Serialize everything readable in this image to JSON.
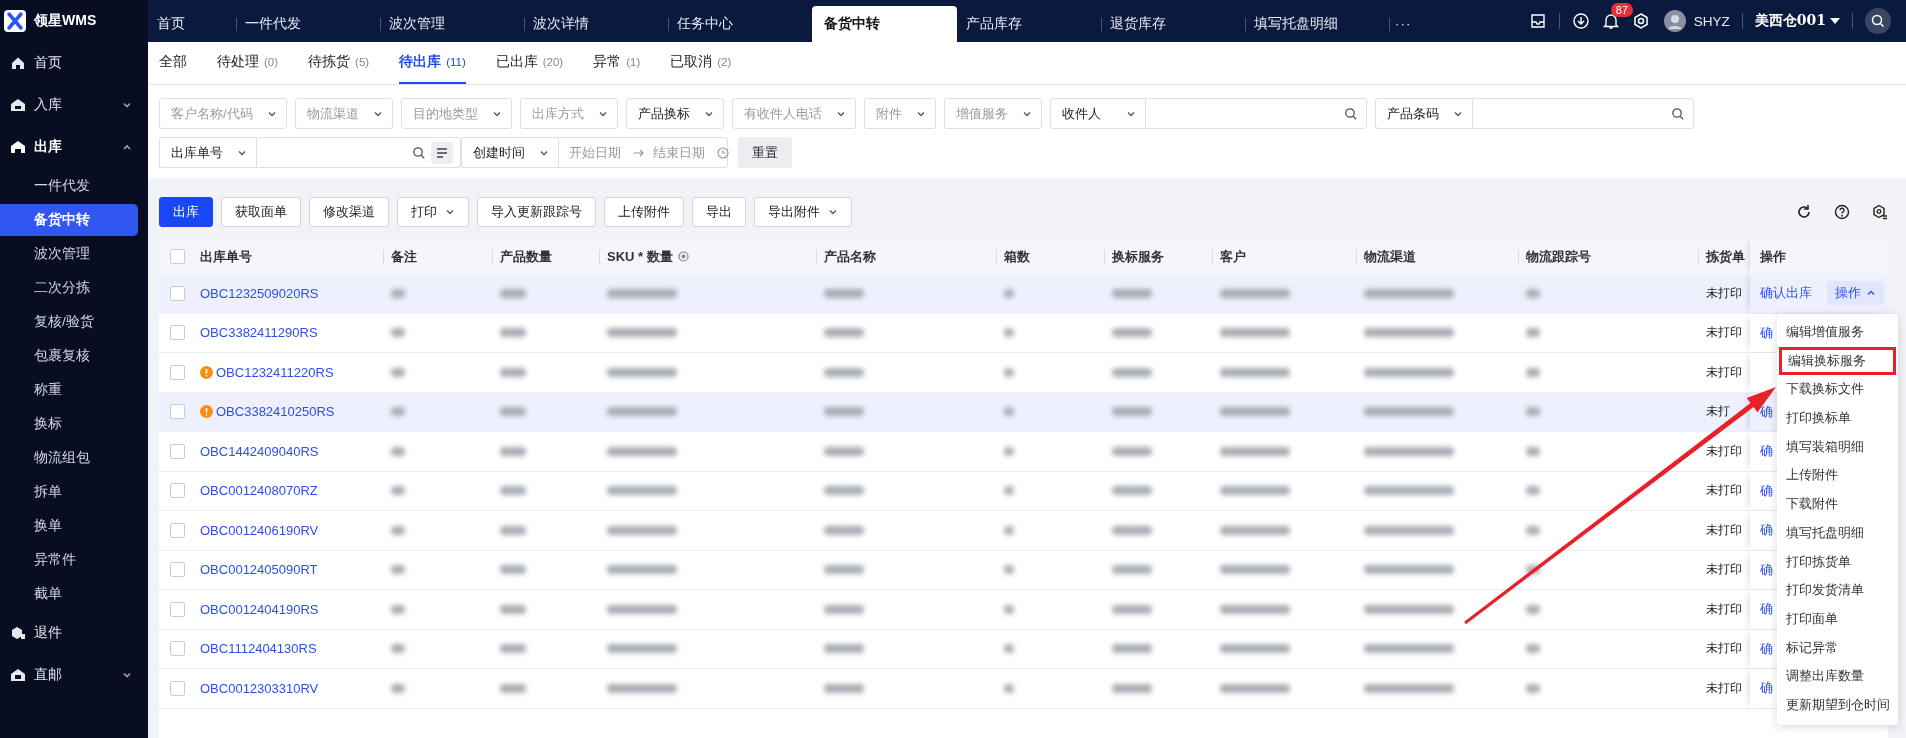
{
  "app": {
    "title": "领星WMS"
  },
  "top_tabs": [
    {
      "label": "首页",
      "selected": false
    },
    {
      "label": "一件代发",
      "selected": false
    },
    {
      "label": "波次管理",
      "selected": false
    },
    {
      "label": "波次详情",
      "selected": false
    },
    {
      "label": "任务中心",
      "selected": false
    },
    {
      "label": "备货中转",
      "selected": true
    },
    {
      "label": "产品库存",
      "selected": false
    },
    {
      "label": "退货库存",
      "selected": false
    },
    {
      "label": "填写托盘明细",
      "selected": false
    },
    {
      "label": "···",
      "selected": false
    }
  ],
  "header": {
    "notifications": "87",
    "user": "SHYZ",
    "warehouse": "美西仓001"
  },
  "sidebar": {
    "items": [
      {
        "label": "首页"
      },
      {
        "label": "入库",
        "expanded": false
      },
      {
        "label": "出库",
        "expanded": true,
        "children": [
          {
            "label": "一件代发",
            "selected": false
          },
          {
            "label": "备货中转",
            "selected": true
          },
          {
            "label": "波次管理",
            "selected": false
          },
          {
            "label": "二次分拣",
            "selected": false
          },
          {
            "label": "复核/验货",
            "selected": false
          },
          {
            "label": "包裹复核",
            "selected": false
          },
          {
            "label": "称重",
            "selected": false
          },
          {
            "label": "换标",
            "selected": false
          },
          {
            "label": "物流组包",
            "selected": false
          },
          {
            "label": "拆单",
            "selected": false
          },
          {
            "label": "换单",
            "selected": false
          },
          {
            "label": "异常件",
            "selected": false
          },
          {
            "label": "截单",
            "selected": false
          }
        ]
      },
      {
        "label": "退件"
      },
      {
        "label": "直邮",
        "expanded": false
      }
    ]
  },
  "status_tabs": [
    {
      "label": "全部",
      "selected": false
    },
    {
      "label": "待处理",
      "count": "(0)",
      "selected": false
    },
    {
      "label": "待拣货",
      "count": "(5)",
      "selected": false
    },
    {
      "label": "待出库",
      "count": "(11)",
      "selected": true
    },
    {
      "label": "已出库",
      "count": "(20)",
      "selected": false
    },
    {
      "label": "异常",
      "count": "(1)",
      "selected": false
    },
    {
      "label": "已取消",
      "count": "(2)",
      "selected": false
    }
  ],
  "filters": [
    [
      {
        "kind": "select",
        "placeholder": "客户名称/代码"
      },
      {
        "kind": "select",
        "placeholder": "物流渠道"
      },
      {
        "kind": "select",
        "placeholder": "目的地类型"
      },
      {
        "kind": "select",
        "placeholder": "出库方式"
      },
      {
        "kind": "select",
        "value": "产品换标"
      },
      {
        "kind": "select",
        "placeholder": "有收件人电话"
      },
      {
        "kind": "select",
        "placeholder": "附件"
      },
      {
        "kind": "select",
        "placeholder": "增值服务"
      },
      {
        "kind": "combo",
        "value": "收件人"
      },
      {
        "kind": "combo",
        "value": "产品条码"
      }
    ],
    [
      {
        "kind": "combo",
        "value": "出库单号",
        "list_button": true
      },
      {
        "kind": "date",
        "value": "创建时间",
        "start_placeholder": "开始日期",
        "end_placeholder": "结束日期"
      },
      {
        "kind": "button",
        "label": "重置"
      }
    ]
  ],
  "toolbar": [
    {
      "label": "出库",
      "kind": "primary"
    },
    {
      "label": "获取面单",
      "kind": "default"
    },
    {
      "label": "修改渠道",
      "kind": "default"
    },
    {
      "label": "打印",
      "kind": "default",
      "dropdown": true
    },
    {
      "label": "导入更新跟踪号",
      "kind": "default"
    },
    {
      "label": "上传附件",
      "kind": "default"
    },
    {
      "label": "导出",
      "kind": "default"
    },
    {
      "label": "导出附件",
      "kind": "default",
      "dropdown": true
    }
  ],
  "table": {
    "select_all": false,
    "columns": [
      {
        "label": "出库单号"
      },
      {
        "label": "备注"
      },
      {
        "label": "产品数量"
      },
      {
        "label": "SKU * 数量",
        "info": true
      },
      {
        "label": "产品名称"
      },
      {
        "label": "箱数"
      },
      {
        "label": "换标服务"
      },
      {
        "label": "客户"
      },
      {
        "label": "物流渠道"
      },
      {
        "label": "物流跟踪号"
      },
      {
        "label": "拣货单"
      },
      {
        "label": "操作"
      }
    ],
    "rows": [
      {
        "checked": false,
        "order_no": "OBC1232509020RS",
        "warning": false,
        "highlighted": true,
        "redacted": true,
        "pick_status": "未打印",
        "confirm": "确认出库",
        "menu_button": {
          "label": "操作",
          "expanded": true
        }
      },
      {
        "checked": false,
        "order_no": "OBC3382411290RS",
        "warning": false,
        "highlighted": false,
        "redacted": true,
        "pick_status": "未打印",
        "confirm": "确"
      },
      {
        "checked": false,
        "order_no": "OBC1232411220RS",
        "warning": true,
        "highlighted": false,
        "redacted": true,
        "pick_status": "未打印"
      },
      {
        "checked": false,
        "order_no": "OBC3382410250RS",
        "warning": true,
        "highlighted": true,
        "redacted": true,
        "pick_status": "未打",
        "confirm": "确"
      },
      {
        "checked": false,
        "order_no": "OBC1442409040RS",
        "warning": false,
        "highlighted": false,
        "redacted": true,
        "pick_status": "未打印",
        "confirm": "确"
      },
      {
        "checked": false,
        "order_no": "OBC0012408070RZ",
        "warning": false,
        "highlighted": false,
        "redacted": true,
        "pick_status": "未打印",
        "confirm": "确"
      },
      {
        "checked": false,
        "order_no": "OBC0012406190RV",
        "warning": false,
        "highlighted": false,
        "redacted": true,
        "pick_status": "未打印",
        "confirm": "确"
      },
      {
        "checked": false,
        "order_no": "OBC0012405090RT",
        "warning": false,
        "highlighted": false,
        "redacted": true,
        "pick_status": "未打印",
        "confirm": "确"
      },
      {
        "checked": false,
        "order_no": "OBC0012404190RS",
        "warning": false,
        "highlighted": false,
        "redacted": true,
        "pick_status": "未打印",
        "confirm": "确"
      },
      {
        "checked": false,
        "order_no": "OBC1112404130RS",
        "warning": false,
        "highlighted": false,
        "redacted": true,
        "pick_status": "未打印",
        "confirm": "确"
      },
      {
        "checked": false,
        "order_no": "OBC0012303310RV",
        "warning": false,
        "highlighted": false,
        "redacted": true,
        "pick_status": "未打印",
        "confirm": "确"
      }
    ]
  },
  "dropdown_menu": {
    "items": [
      {
        "label": "编辑增值服务",
        "callout": false
      },
      {
        "label": "编辑换标服务",
        "callout": true
      },
      {
        "label": "下载换标文件",
        "callout": false
      },
      {
        "label": "打印换标单",
        "callout": false
      },
      {
        "label": "填写装箱明细",
        "callout": false
      },
      {
        "label": "上传附件",
        "callout": false
      },
      {
        "label": "下载附件",
        "callout": false
      },
      {
        "label": "填写托盘明细",
        "callout": false
      },
      {
        "label": "打印拣货单",
        "callout": false
      },
      {
        "label": "打印发货清单",
        "callout": false
      },
      {
        "label": "打印面单",
        "callout": false
      },
      {
        "label": "标记异常",
        "callout": false
      },
      {
        "label": "调整出库数量",
        "callout": false
      },
      {
        "label": "更新期望到仓时间",
        "callout": false
      }
    ]
  }
}
